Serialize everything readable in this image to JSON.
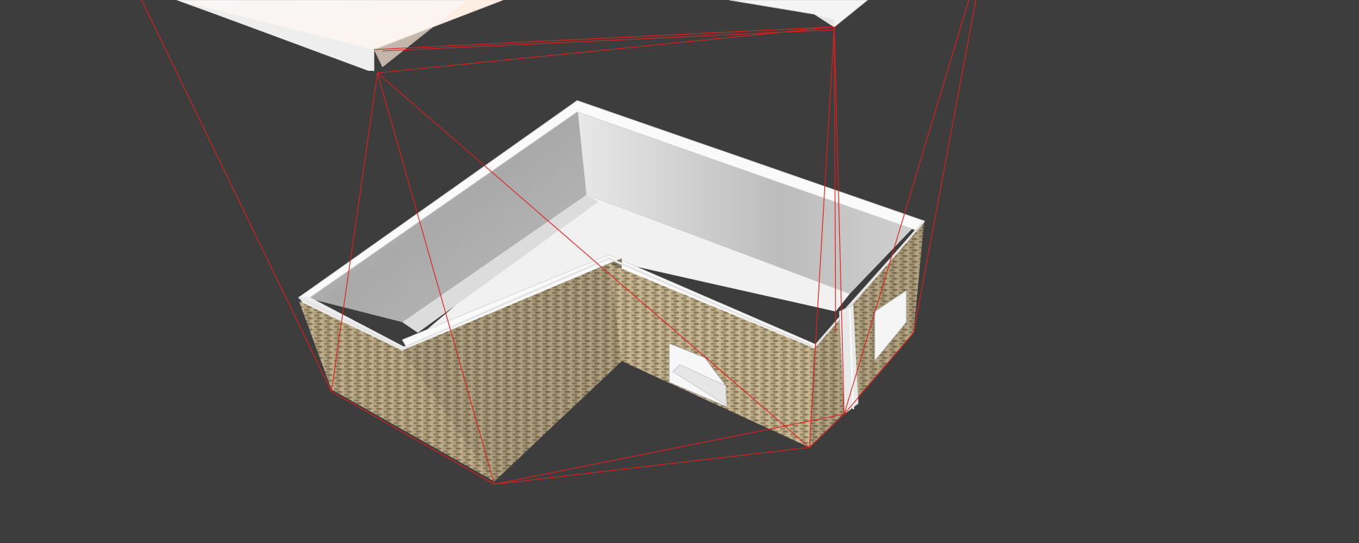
{
  "viewport": {
    "background_color": "#3d3d3d",
    "tool": "3d-model-viewer",
    "selection_outline_color": "#e01e1e"
  },
  "scene": {
    "objects": [
      {
        "name": "roof-section-left",
        "material": "white-plaster",
        "state": "exploded"
      },
      {
        "name": "roof-section-right",
        "material": "white-plaster",
        "state": "exploded"
      },
      {
        "name": "l-shaped-building",
        "material": "brick",
        "state": "open-top"
      },
      {
        "name": "garage-door",
        "material": "white"
      },
      {
        "name": "side-window",
        "material": "white"
      },
      {
        "name": "downpipe",
        "material": "white"
      }
    ],
    "colors": {
      "brick": "#a08e6a",
      "brick_mortar": "#d2c6a6",
      "plaster": "#f2f2f2",
      "interior_wall": "#b9b9b9",
      "selection": "#e01e1e"
    }
  }
}
